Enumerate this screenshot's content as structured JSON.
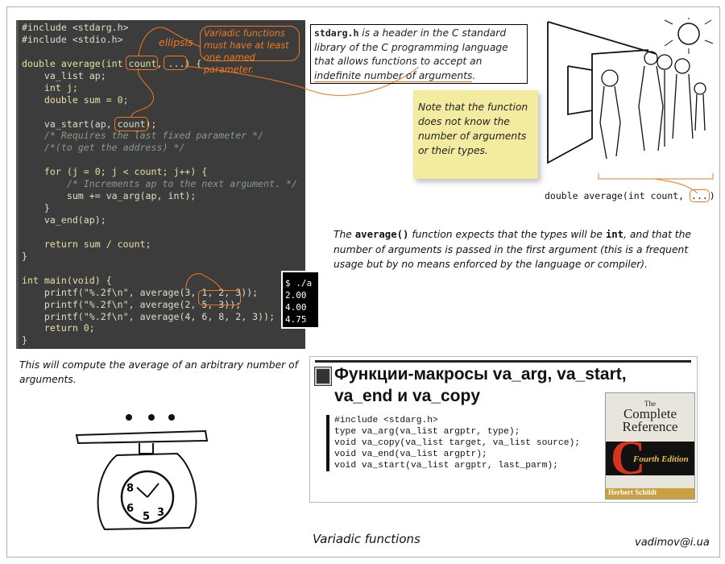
{
  "code": {
    "lines": [
      {
        "t": "#include <stdarg.h>",
        "c": ""
      },
      {
        "t": "#include <stdio.h>",
        "c": ""
      },
      {
        "t": "",
        "c": ""
      },
      {
        "t": "double average(int count, ...) {",
        "c": "kw"
      },
      {
        "t": "    va_list ap;",
        "c": ""
      },
      {
        "t": "    int j;",
        "c": "kw"
      },
      {
        "t": "    double sum = 0;",
        "c": "kw"
      },
      {
        "t": "",
        "c": ""
      },
      {
        "t": "    va_start(ap, count);",
        "c": ""
      },
      {
        "t": "    /* Requires the last fixed parameter */",
        "c": "cm"
      },
      {
        "t": "    /*(to get the address) */",
        "c": "cm"
      },
      {
        "t": "",
        "c": ""
      },
      {
        "t": "    for (j = 0; j < count; j++) {",
        "c": "kw"
      },
      {
        "t": "        /* Increments ap to the next argument. */",
        "c": "cm"
      },
      {
        "t": "        sum += va_arg(ap, int);",
        "c": ""
      },
      {
        "t": "    }",
        "c": ""
      },
      {
        "t": "    va_end(ap);",
        "c": ""
      },
      {
        "t": "",
        "c": ""
      },
      {
        "t": "    return sum / count;",
        "c": "kw"
      },
      {
        "t": "}",
        "c": ""
      },
      {
        "t": "",
        "c": ""
      },
      {
        "t": "int main(void) {",
        "c": "kw"
      },
      {
        "t": "    printf(\"%.2f\\n\", average(3, 1, 2, 3));",
        "c": ""
      },
      {
        "t": "    printf(\"%.2f\\n\", average(2, 5, 3));",
        "c": ""
      },
      {
        "t": "    printf(\"%.2f\\n\", average(4, 6, 8, 2, 3));",
        "c": ""
      },
      {
        "t": "    return 0;",
        "c": "kw"
      },
      {
        "t": "}",
        "c": ""
      }
    ]
  },
  "annotations": {
    "ellipsis": "ellipsis",
    "variadic_note": "Variadic functions must have at least one named parameter."
  },
  "terminal": {
    "lines": [
      "$ ./a",
      "2.00",
      "4.00",
      "4.75"
    ]
  },
  "definition": {
    "keyword": "stdarg.h",
    "text_before": " is a header in the C standard library of the C programming language that allows functions to accept an ",
    "underlined": "indefinite number of arguments",
    "text_after": "."
  },
  "sticky_note": "Note that the function does not know the number of arguments or their types.",
  "signature": {
    "prefix": "double average(int count, ",
    "ellipsis": "...",
    "suffix": ")"
  },
  "explanation": {
    "p1": "The ",
    "fn": "average()",
    "p2": " function expects that the types will be ",
    "type": "int",
    "p3": ", and that the number of arguments is passed in the first argument (this is a frequent usage but by no means enforced by the language or compiler)."
  },
  "caption_scale": "This will compute the average of an arbitrary number of arguments.",
  "book": {
    "heading": "Функции-макросы va_arg, va_start, va_end и va_copy",
    "code": "#include <stdarg.h>\ntype va_arg(va_list argptr, type);\nvoid va_copy(va_list target, va_list source);\nvoid va_end(va_list argptr);\nvoid va_start(va_list argptr, last_parm);",
    "cover": {
      "the": "The",
      "title1": "Complete",
      "title2": "Reference",
      "letter": "C",
      "edition": "Fourth Edition",
      "author": "Herbert Schildt"
    }
  },
  "footer": {
    "title": "Variadic functions",
    "email": "vadimov@i.ua"
  },
  "colors": {
    "accent": "#f07820",
    "code_bg": "#3c3c3c",
    "note_bg": "#f3eba0"
  }
}
